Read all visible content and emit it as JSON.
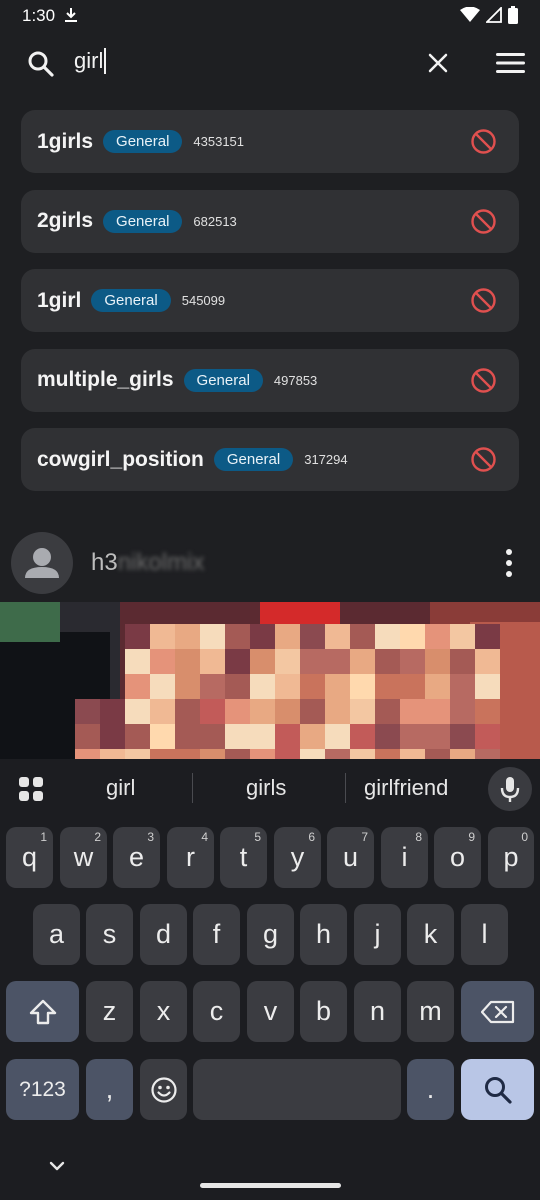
{
  "status": {
    "time": "1:30",
    "icons": [
      "download-icon",
      "wifi-icon",
      "signal-icon",
      "battery-icon"
    ]
  },
  "search": {
    "query": "girl",
    "icon": "search-icon",
    "clear_icon": "close-icon",
    "menu_icon": "hamburger-menu-icon"
  },
  "suggestions": [
    {
      "tag": "1girls",
      "category": "General",
      "count": "4353151"
    },
    {
      "tag": "2girls",
      "category": "General",
      "count": "682513"
    },
    {
      "tag": "1girl",
      "category": "General",
      "count": "545099"
    },
    {
      "tag": "multiple_girls",
      "category": "General",
      "count": "497853"
    },
    {
      "tag": "cowgirl_position",
      "category": "General",
      "count": "317294"
    }
  ],
  "post": {
    "username_visible": "h3",
    "username_blurred": "nikolmix",
    "more_icon": "more-vertical-icon"
  },
  "keyboard": {
    "suggestions": [
      "girl",
      "girls",
      "girlfriend"
    ],
    "row1": [
      {
        "k": "q",
        "n": "1"
      },
      {
        "k": "w",
        "n": "2"
      },
      {
        "k": "e",
        "n": "3"
      },
      {
        "k": "r",
        "n": "4"
      },
      {
        "k": "t",
        "n": "5"
      },
      {
        "k": "y",
        "n": "6"
      },
      {
        "k": "u",
        "n": "7"
      },
      {
        "k": "i",
        "n": "8"
      },
      {
        "k": "o",
        "n": "9"
      },
      {
        "k": "p",
        "n": "0"
      }
    ],
    "row2": [
      "a",
      "s",
      "d",
      "f",
      "g",
      "h",
      "j",
      "k",
      "l"
    ],
    "row3": [
      "z",
      "x",
      "c",
      "v",
      "b",
      "n",
      "m"
    ],
    "symbols_label": "?123",
    "comma": ",",
    "period": "."
  },
  "colors": {
    "badge": "#0c5a86",
    "block_icon": "#e0504f",
    "search_key": "#b9c6e6"
  }
}
